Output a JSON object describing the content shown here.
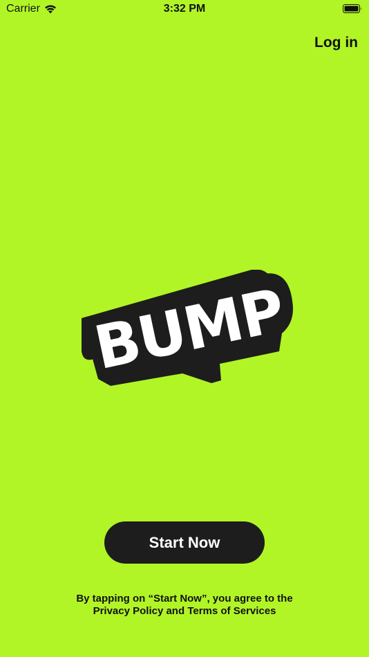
{
  "status_bar": {
    "carrier": "Carrier",
    "time": "3:32 PM",
    "wifi_icon": "wifi-icon",
    "battery_icon": "battery-full-icon"
  },
  "header": {
    "login_label": "Log in"
  },
  "logo": {
    "text": "BUMP",
    "colors": {
      "letters": "#ffffff",
      "shadow": "#1d1d1d",
      "outline": "#1d1d1d"
    }
  },
  "cta": {
    "start_label": "Start Now"
  },
  "legal": {
    "line1": "By tapping on “Start Now”, you agree to the",
    "privacy_label": "Privacy Policy",
    "and": "and",
    "terms_label": "Terms of Services"
  },
  "colors": {
    "background": "#b1f526",
    "button": "#1d1d1d",
    "text": "#111111"
  }
}
